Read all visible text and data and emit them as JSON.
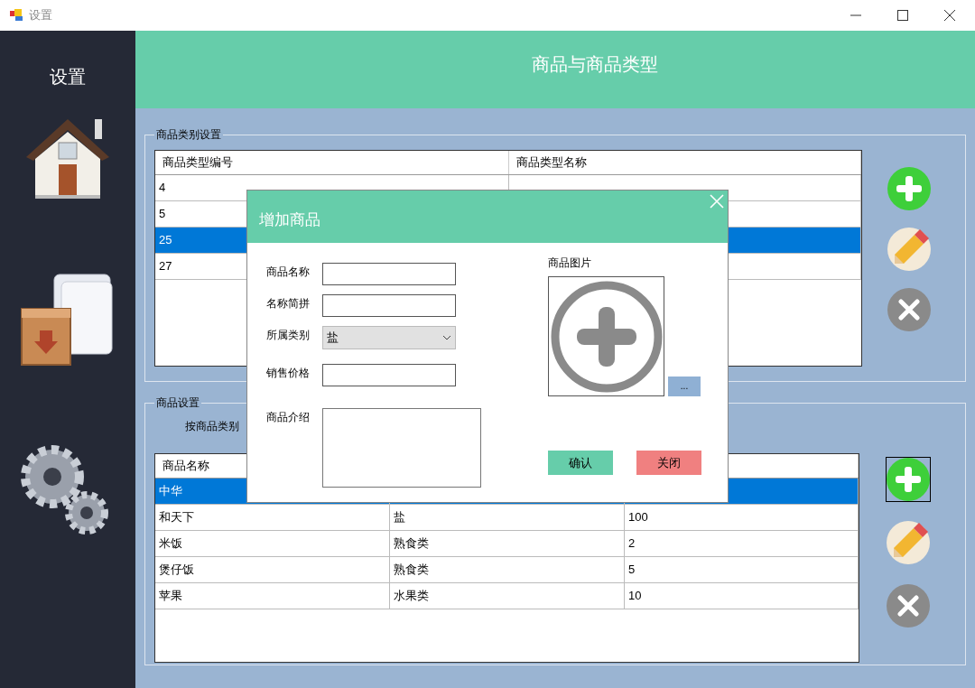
{
  "window": {
    "title": "设置"
  },
  "sidebar": {
    "title": "设置",
    "items": [
      {
        "kind": "home"
      },
      {
        "kind": "box"
      },
      {
        "kind": "gears"
      }
    ]
  },
  "header": {
    "title": "商品与商品类型"
  },
  "category_group": {
    "legend": "商品类别设置",
    "table": {
      "columns": [
        "商品类型编号",
        "商品类型名称"
      ],
      "rows": [
        {
          "cells": [
            "4"
          ],
          "selected": false
        },
        {
          "cells": [
            "5"
          ],
          "selected": false
        },
        {
          "cells": [
            "25"
          ],
          "selected": true
        },
        {
          "cells": [
            "27"
          ],
          "selected": false
        }
      ]
    },
    "buttons": [
      {
        "kind": "add",
        "focused": false
      },
      {
        "kind": "edit",
        "focused": false
      },
      {
        "kind": "delete",
        "focused": false
      }
    ]
  },
  "product_group": {
    "legend": "商品设置",
    "filter_label": "按商品类别",
    "table": {
      "columns": [
        "商品名称"
      ],
      "rows": [
        {
          "cells": [
            "中华"
          ],
          "selected": true
        },
        {
          "cells": [
            "和天下",
            "盐",
            "100"
          ],
          "selected": false
        },
        {
          "cells": [
            "米饭",
            "熟食类",
            "2"
          ],
          "selected": false
        },
        {
          "cells": [
            "煲仔饭",
            "熟食类",
            "5"
          ],
          "selected": false
        },
        {
          "cells": [
            "苹果",
            "水果类",
            "10"
          ],
          "selected": false
        }
      ]
    },
    "buttons": [
      {
        "kind": "add",
        "focused": true
      },
      {
        "kind": "edit",
        "focused": false
      },
      {
        "kind": "delete",
        "focused": false
      }
    ]
  },
  "dialog": {
    "title": "增加商品",
    "fields": [
      {
        "label": "商品名称",
        "kind": "text"
      },
      {
        "label": "名称简拼",
        "kind": "text"
      },
      {
        "label": "所属类别",
        "kind": "select",
        "value": "盐"
      },
      {
        "label": "销售价格",
        "kind": "text"
      },
      {
        "label": "商品介绍",
        "kind": "textarea"
      }
    ],
    "image_label": "商品图片",
    "browse_button": "...",
    "buttons": [
      {
        "label": "确认",
        "kind": "confirm"
      },
      {
        "label": "关闭",
        "kind": "close"
      }
    ]
  }
}
